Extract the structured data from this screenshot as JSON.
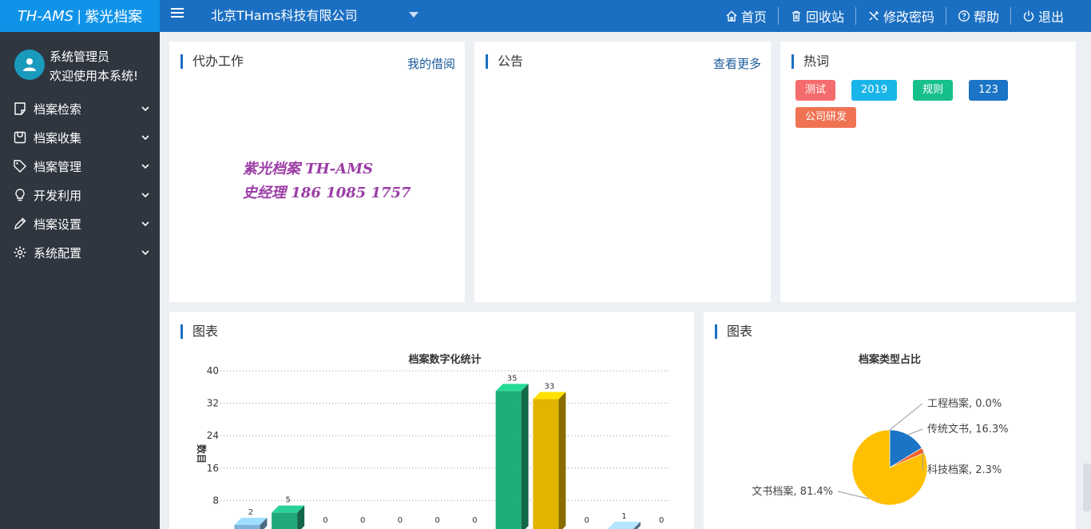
{
  "header": {
    "logo_en": "TH-AMS",
    "logo_sep": "|",
    "logo_cn": "紫光档案",
    "company": "北京THams科技有限公司",
    "nav": [
      {
        "label": "首页",
        "icon": "home-icon"
      },
      {
        "label": "回收站",
        "icon": "trash-icon"
      },
      {
        "label": "修改密码",
        "icon": "tools-icon"
      },
      {
        "label": "帮助",
        "icon": "help-icon"
      },
      {
        "label": "退出",
        "icon": "power-icon"
      }
    ]
  },
  "sidebar": {
    "user_name": "系统管理员",
    "welcome": "欢迎使用本系统!",
    "items": [
      {
        "label": "档案检索",
        "icon": "note-icon"
      },
      {
        "label": "档案收集",
        "icon": "bag-icon"
      },
      {
        "label": "档案管理",
        "icon": "tag-icon"
      },
      {
        "label": "开发利用",
        "icon": "bulb-icon"
      },
      {
        "label": "档案设置",
        "icon": "pencil-icon"
      },
      {
        "label": "系统配置",
        "icon": "gear-icon"
      }
    ]
  },
  "todo": {
    "title": "代办工作",
    "link": "我的借阅",
    "watermark_line1": "紫光档案 TH-AMS",
    "watermark_line2": "史经理  186 1085 1757"
  },
  "notice": {
    "title": "公告",
    "link": "查看更多"
  },
  "hotwords": {
    "title": "热词",
    "tags": [
      {
        "label": "测试",
        "color": "#f56c6c"
      },
      {
        "label": "2019",
        "color": "#19b5e8"
      },
      {
        "label": "规则",
        "color": "#17c08a"
      },
      {
        "label": "123",
        "color": "#1b74c5"
      },
      {
        "label": "公司研发",
        "color": "#ef7353"
      }
    ]
  },
  "bar_panel": {
    "title": "图表",
    "chart_title": "档案数字化统计",
    "ylabel": "数目"
  },
  "pie_panel": {
    "title": "图表",
    "chart_title": "档案类型占比"
  },
  "chart_data": [
    {
      "type": "bar",
      "title": "档案数字化统计",
      "ylabel": "数目",
      "ylim": [
        0,
        40
      ],
      "yticks": [
        0,
        8,
        16,
        24,
        32,
        40
      ],
      "values": [
        2,
        5,
        0,
        0,
        0,
        0,
        0,
        35,
        33,
        0,
        1,
        0
      ],
      "colors": [
        "#7fb2d9",
        "#22a879",
        "#999999",
        "#999999",
        "#999999",
        "#999999",
        "#999999",
        "#1fae77",
        "#e2b400",
        "#999999",
        "#8fb7d6",
        "#999999"
      ],
      "grid": true
    },
    {
      "type": "pie",
      "title": "档案类型占比",
      "slices": [
        {
          "label": "工程档案",
          "value": 0.0,
          "color": "#2e7bb8"
        },
        {
          "label": "传统文书",
          "value": 16.3,
          "color": "#1b74c5"
        },
        {
          "label": "科技档案",
          "value": 2.3,
          "color": "#f2602d"
        },
        {
          "label": "文书档案",
          "value": 81.4,
          "color": "#fec000"
        }
      ]
    }
  ]
}
